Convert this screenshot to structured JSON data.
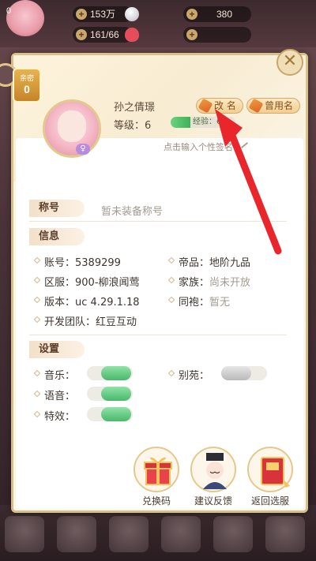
{
  "topbar": {
    "level_label": "0",
    "silver": "153万",
    "gems": "380",
    "energy": "161/66"
  },
  "close_symbol": "✕",
  "ribbon": {
    "top_text": "亲密",
    "bottom_text": "0"
  },
  "profile": {
    "name": "孙之倩璟",
    "level": "等级：6",
    "xp_label": "经验：6/",
    "xp_progress": 0.3,
    "rename_label": "改 名",
    "former_names_label": "曾用名",
    "signature_placeholder": "点击输入个性签名",
    "gender_symbol": "♀"
  },
  "sections": {
    "title": {
      "heading": "称号",
      "value": "暂未装备称号"
    },
    "info": {
      "heading": "信息",
      "items": [
        {
          "key": "账号：",
          "value": "5389299"
        },
        {
          "key": "帝品：",
          "value": "地阶九品"
        },
        {
          "key": "区服：",
          "value": "900-柳浪闻莺"
        },
        {
          "key": "家族：",
          "value": "尚未开放"
        },
        {
          "key": "版本：",
          "value": "uc 4.29.1.18"
        },
        {
          "key": "同袍：",
          "value": "暂无"
        },
        {
          "key": "开发团队：",
          "value": "红豆互动"
        }
      ]
    },
    "settings": {
      "heading": "设置",
      "toggles": [
        {
          "label": "音乐：",
          "on": true
        },
        {
          "label": "别苑：",
          "on": false
        },
        {
          "label": "语音：",
          "on": true
        },
        {
          "label": "特效：",
          "on": true
        }
      ]
    }
  },
  "actions": [
    {
      "label": "兑换码",
      "icon": "gift-box-icon"
    },
    {
      "label": "建议反馈",
      "icon": "advisor-icon"
    },
    {
      "label": "返回选服",
      "icon": "book-icon"
    }
  ],
  "colors": {
    "accent": "#d9c08a",
    "toggle_on": "#49b86b",
    "arrow": "#e8262b"
  }
}
